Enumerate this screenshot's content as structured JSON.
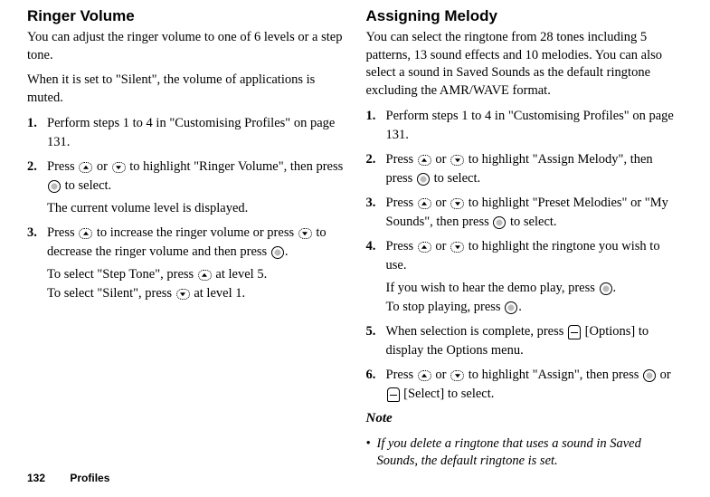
{
  "left": {
    "heading": "Ringer Volume",
    "intro1": "You can adjust the ringer volume to one of 6 levels or a step tone.",
    "intro2": "When it is set to \"Silent\", the volume of applications is muted.",
    "steps": [
      {
        "num": "1.",
        "parts": [
          {
            "t": "Perform steps 1 to 4 in \"Customising Profiles\" on page 131."
          }
        ]
      },
      {
        "num": "2.",
        "parts": [
          {
            "t": "Press "
          },
          {
            "icon": "up"
          },
          {
            "t": " or "
          },
          {
            "icon": "down"
          },
          {
            "t": " to highlight \"Ringer Volume\", then press "
          },
          {
            "icon": "circle"
          },
          {
            "t": " to select."
          }
        ],
        "sub": [
          {
            "t": "The current volume level is displayed."
          }
        ]
      },
      {
        "num": "3.",
        "parts": [
          {
            "t": "Press "
          },
          {
            "icon": "up"
          },
          {
            "t": " to increase the ringer volume or press "
          },
          {
            "icon": "down"
          },
          {
            "t": " to decrease the ringer volume and then press "
          },
          {
            "icon": "circle"
          },
          {
            "t": "."
          }
        ],
        "sub": [
          {
            "t": "To select \"Step Tone\", press "
          },
          {
            "icon": "up"
          },
          {
            "t": " at level 5."
          },
          {
            "br": true
          },
          {
            "t": "To select \"Silent\", press "
          },
          {
            "icon": "down"
          },
          {
            "t": " at level 1."
          }
        ]
      }
    ]
  },
  "right": {
    "heading": "Assigning Melody",
    "intro1": "You can select the ringtone from 28 tones including 5 patterns, 13 sound effects and 10 melodies. You can also select a sound in Saved Sounds as the default ringtone excluding the AMR/WAVE format.",
    "steps": [
      {
        "num": "1.",
        "parts": [
          {
            "t": "Perform steps 1 to 4 in \"Customising Profiles\" on page 131."
          }
        ]
      },
      {
        "num": "2.",
        "parts": [
          {
            "t": "Press "
          },
          {
            "icon": "up"
          },
          {
            "t": " or "
          },
          {
            "icon": "down"
          },
          {
            "t": " to highlight \"Assign Melody\", then press "
          },
          {
            "icon": "circle"
          },
          {
            "t": " to select."
          }
        ]
      },
      {
        "num": "3.",
        "parts": [
          {
            "t": "Press "
          },
          {
            "icon": "up"
          },
          {
            "t": " or "
          },
          {
            "icon": "down"
          },
          {
            "t": " to highlight \"Preset Melodies\" or \"My Sounds\", then press "
          },
          {
            "icon": "circle"
          },
          {
            "t": " to select."
          }
        ]
      },
      {
        "num": "4.",
        "parts": [
          {
            "t": "Press "
          },
          {
            "icon": "up"
          },
          {
            "t": " or "
          },
          {
            "icon": "down"
          },
          {
            "t": " to highlight the ringtone you wish to use."
          }
        ],
        "sub": [
          {
            "t": "If you wish to hear the demo play, press "
          },
          {
            "icon": "circle"
          },
          {
            "t": "."
          },
          {
            "br": true
          },
          {
            "t": "To stop playing, press "
          },
          {
            "icon": "circle"
          },
          {
            "t": "."
          }
        ]
      },
      {
        "num": "5.",
        "parts": [
          {
            "t": "When selection is complete, press "
          },
          {
            "icon": "soft"
          },
          {
            "t": " [Options] to display the Options menu."
          }
        ]
      },
      {
        "num": "6.",
        "parts": [
          {
            "t": "Press "
          },
          {
            "icon": "up"
          },
          {
            "t": " or "
          },
          {
            "icon": "down"
          },
          {
            "t": " to highlight \"Assign\", then press "
          },
          {
            "icon": "circle"
          },
          {
            "t": " or "
          },
          {
            "icon": "soft"
          },
          {
            "t": " [Select] to select."
          }
        ]
      }
    ],
    "note_heading": "Note",
    "note_bullet": "•",
    "note_body": "If you delete a ringtone that uses a sound in Saved Sounds, the default ringtone is set."
  },
  "footer": {
    "page": "132",
    "section": "Profiles"
  }
}
